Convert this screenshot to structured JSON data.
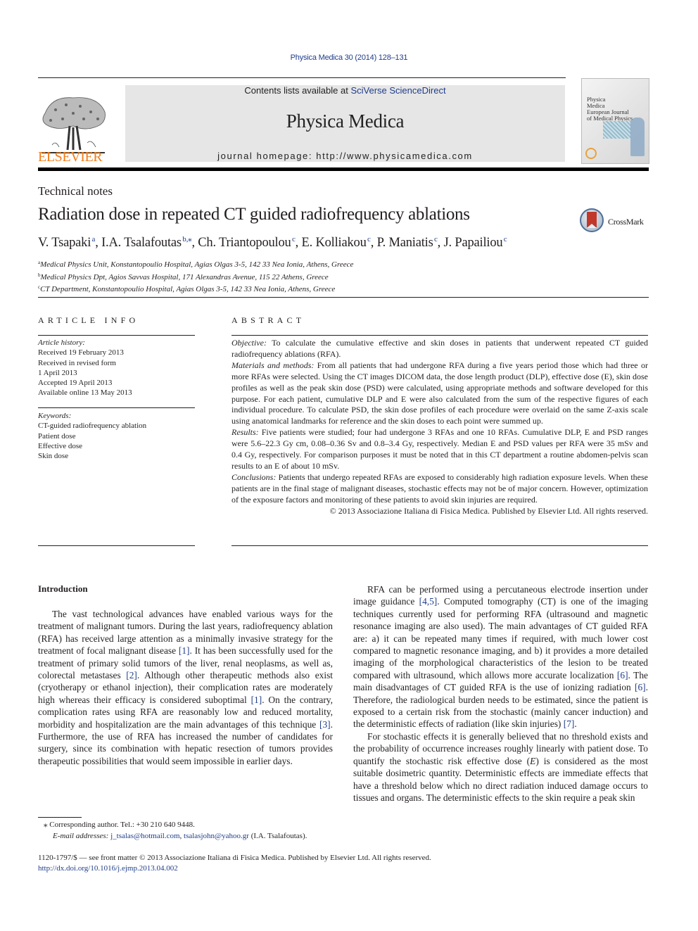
{
  "citation": "Physica Medica 30 (2014) 128–131",
  "header": {
    "publisher_wordmark": "ELSEVIER",
    "contents_prefix": "Contents lists available at ",
    "contents_link": "SciVerse ScienceDirect",
    "journal_name": "Physica Medica",
    "homepage": "journal homepage: http://www.physicamedica.com",
    "cover_title_line1": "Physica",
    "cover_title_line2": "Medica",
    "cover_title_line3": "European Journal",
    "cover_title_line4": "of Medical Physics"
  },
  "article": {
    "section_type": "Technical notes",
    "title": "Radiation dose in repeated CT guided radiofrequency ablations",
    "crossmark_label": "CrossMark",
    "authors": [
      {
        "name": "V. Tsapaki",
        "sup": "a"
      },
      {
        "name": "I.A. Tsalafoutas",
        "sup": "b,⁎"
      },
      {
        "name": "Ch. Triantopoulou",
        "sup": "c"
      },
      {
        "name": "E. Kolliakou",
        "sup": "c"
      },
      {
        "name": "P. Maniatis",
        "sup": "c"
      },
      {
        "name": "J. Papailiou",
        "sup": "c"
      }
    ],
    "affiliations": [
      {
        "sup": "a",
        "text": "Medical Physics Unit, Konstantopoulio Hospital, Agias Olgas 3-5, 142 33 Nea Ionia, Athens, Greece"
      },
      {
        "sup": "b",
        "text": "Medical Physics Dpt, Agios Savvas Hospital, 171 Alexandras Avenue, 115 22 Athens, Greece"
      },
      {
        "sup": "c",
        "text": "CT Department, Konstantopoulio Hospital, Agias Olgas 3-5, 142 33 Nea Ionia, Athens, Greece"
      }
    ]
  },
  "article_info": {
    "heading": "ARTICLE INFO",
    "history_label": "Article history:",
    "history": [
      "Received 19 February 2013",
      "Received in revised form",
      "1 April 2013",
      "Accepted 19 April 2013",
      "Available online 13 May 2013"
    ],
    "keywords_label": "Keywords:",
    "keywords": [
      "CT-guided radiofrequency ablation",
      "Patient dose",
      "Effective dose",
      "Skin dose"
    ]
  },
  "abstract": {
    "heading": "ABSTRACT",
    "objective_label": "Objective:",
    "objective": " To calculate the cumulative effective and skin doses in patients that underwent repeated CT guided radiofrequency ablations (RFA).",
    "methods_label": "Materials and methods:",
    "methods": " From all patients that had undergone RFA during a five years period those which had three or more RFAs were selected. Using the CT images DICOM data, the dose length product (DLP), effective dose (E), skin dose profiles as well as the peak skin dose (PSD) were calculated, using appropriate methods and software developed for this purpose. For each patient, cumulative DLP and E were also calculated from the sum of the respective figures of each individual procedure. To calculate PSD, the skin dose profiles of each procedure were overlaid on the same Z-axis scale using anatomical landmarks for reference and the skin doses to each point were summed up.",
    "results_label": "Results:",
    "results": " Five patients were studied; four had undergone 3 RFAs and one 10 RFAs. Cumulative DLP, E and PSD ranges were 5.6–22.3 Gy cm, 0.08–0.36 Sv and 0.8–3.4 Gy, respectively. Median E and PSD values per RFA were 35 mSv and 0.4 Gy, respectively. For comparison purposes it must be noted that in this CT department a routine abdomen-pelvis scan results to an E of about 10 mSv.",
    "conclusions_label": "Conclusions:",
    "conclusions": " Patients that undergo repeated RFAs are exposed to considerably high radiation exposure levels. When these patients are in the final stage of malignant diseases, stochastic effects may not be of major concern. However, optimization of the exposure factors and monitoring of these patients to avoid skin injuries are required.",
    "copyright": "© 2013 Associazione Italiana di Fisica Medica. Published by Elsevier Ltd. All rights reserved."
  },
  "body": {
    "intro_heading": "Introduction",
    "left_p1": [
      {
        "t": "The vast technological advances have enabled various ways for the treatment of malignant tumors. During the last years, radiofrequency ablation (RFA) has received large attention as a minimally invasive strategy for the treatment of focal malignant disease "
      },
      {
        "ref": "[1]"
      },
      {
        "t": ". It has been successfully used for the treatment of primary solid tumors of the liver, renal neoplasms, as well as, colorectal metastases "
      },
      {
        "ref": "[2]"
      },
      {
        "t": ". Although other therapeutic methods also exist (cryotherapy or ethanol injection), their complication rates are moderately high whereas their efficacy is considered suboptimal "
      },
      {
        "ref": "[1]"
      },
      {
        "t": ". On the contrary, complication rates using RFA are reasonably low and reduced mortality, morbidity and hospitalization are the main advantages of this technique "
      },
      {
        "ref": "[3]"
      },
      {
        "t": ". Furthermore, the use of RFA has increased the number of candidates for surgery, since its combination with hepatic resection of tumors provides therapeutic possibilities that would seem impossible in earlier days."
      }
    ],
    "right_p1": [
      {
        "t": "RFA can be performed using a percutaneous electrode insertion under image guidance "
      },
      {
        "ref": "[4,5]"
      },
      {
        "t": ". Computed tomography (CT) is one of the imaging techniques currently used for performing RFA (ultrasound and magnetic resonance imaging are also used). The main advantages of CT guided RFA are: a) it can be repeated many times if required, with much lower cost compared to magnetic resonance imaging, and b) it provides a more detailed imaging of the morphological characteristics of the lesion to be treated compared with ultrasound, which allows more accurate localization "
      },
      {
        "ref": "[6]"
      },
      {
        "t": ". The main disadvantages of CT guided RFA is the use of ionizing radiation "
      },
      {
        "ref": "[6]"
      },
      {
        "t": ". Therefore, the radiological burden needs to be estimated, since the patient is exposed to a certain risk from the stochastic (mainly cancer induction) and the deterministic effects of radiation (like skin injuries) "
      },
      {
        "ref": "[7]"
      },
      {
        "t": "."
      }
    ],
    "right_p2": [
      {
        "t": "For stochastic effects it is generally believed that no threshold exists and the probability of occurrence increases roughly linearly with patient dose. To quantify the stochastic risk effective dose ("
      },
      {
        "i": "E"
      },
      {
        "t": ") is considered as the most suitable dosimetric quantity. Deterministic effects are immediate effects that have a threshold below which no direct radiation induced damage occurs to tissues and organs. The deterministic effects to the skin require a peak skin"
      }
    ]
  },
  "footnote": {
    "corresponding": "⁎ Corresponding author. Tel.: +30 210 640 9448.",
    "email_label": "E-mail addresses:",
    "email1": "j_tsalas@hotmail.com",
    "email2": "tsalasjohn@yahoo.gr",
    "email_suffix": " (I.A. Tsalafoutas)."
  },
  "footer": {
    "front_matter": "1120-1797/$ — see front matter © 2013 Associazione Italiana di Fisica Medica. Published by Elsevier Ltd. All rights reserved.",
    "doi": "http://dx.doi.org/10.1016/j.ejmp.2013.04.002"
  },
  "colors": {
    "link": "#1f3d8a",
    "elsevier_orange": "#f07d1b",
    "banner_gray": "#e6e6e6"
  }
}
